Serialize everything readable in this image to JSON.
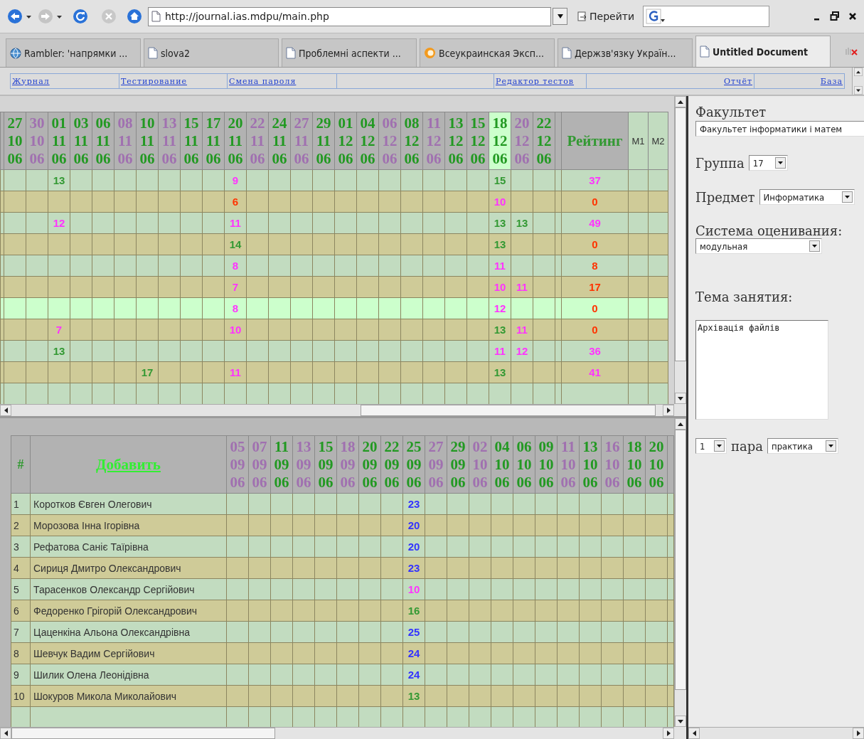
{
  "toolbar": {
    "url": "http://journal.ias.mdpu/main.php",
    "go_button": "Перейти"
  },
  "tabs": [
    {
      "label": "Rambler: 'напрямки ...",
      "kind": "globe",
      "selected": false
    },
    {
      "label": "slova2",
      "kind": "page",
      "selected": false
    },
    {
      "label": "Проблемні аспекти ...",
      "kind": "page",
      "selected": false
    },
    {
      "label": "Всеукраинская Эксп...",
      "kind": "flame",
      "selected": false
    },
    {
      "label": "Держзв'язку Україн...",
      "kind": "page",
      "selected": false
    },
    {
      "label": "Untitled Document",
      "kind": "page",
      "selected": true
    }
  ],
  "nav": {
    "left": [
      "Журнал",
      "Тестирование",
      "Смена пароля"
    ],
    "right": [
      "Редактор тестов",
      "Отчёт",
      "База"
    ]
  },
  "grades": {
    "columns": [
      {
        "day": "27",
        "month": "10",
        "year": "06",
        "color": "#229922",
        "selected": false
      },
      {
        "day": "30",
        "month": "10",
        "year": "06",
        "color": "#a070b0",
        "selected": false
      },
      {
        "day": "01",
        "month": "11",
        "year": "06",
        "color": "#229922",
        "selected": false
      },
      {
        "day": "03",
        "month": "11",
        "year": "06",
        "color": "#229922",
        "selected": false
      },
      {
        "day": "06",
        "month": "11",
        "year": "06",
        "color": "#229922",
        "selected": false
      },
      {
        "day": "08",
        "month": "11",
        "year": "06",
        "color": "#a070b0",
        "selected": false
      },
      {
        "day": "10",
        "month": "11",
        "year": "06",
        "color": "#229922",
        "selected": false
      },
      {
        "day": "13",
        "month": "11",
        "year": "06",
        "color": "#a070b0",
        "selected": false
      },
      {
        "day": "15",
        "month": "11",
        "year": "06",
        "color": "#229922",
        "selected": false
      },
      {
        "day": "17",
        "month": "11",
        "year": "06",
        "color": "#229922",
        "selected": false
      },
      {
        "day": "20",
        "month": "11",
        "year": "06",
        "color": "#229922",
        "selected": false
      },
      {
        "day": "22",
        "month": "11",
        "year": "06",
        "color": "#a070b0",
        "selected": false
      },
      {
        "day": "24",
        "month": "11",
        "year": "06",
        "color": "#229922",
        "selected": false
      },
      {
        "day": "27",
        "month": "11",
        "year": "06",
        "color": "#a070b0",
        "selected": false
      },
      {
        "day": "29",
        "month": "11",
        "year": "06",
        "color": "#229922",
        "selected": false
      },
      {
        "day": "01",
        "month": "12",
        "year": "06",
        "color": "#229922",
        "selected": false
      },
      {
        "day": "04",
        "month": "12",
        "year": "06",
        "color": "#229922",
        "selected": false
      },
      {
        "day": "06",
        "month": "12",
        "year": "06",
        "color": "#a070b0",
        "selected": false
      },
      {
        "day": "08",
        "month": "12",
        "year": "06",
        "color": "#229922",
        "selected": false
      },
      {
        "day": "11",
        "month": "12",
        "year": "06",
        "color": "#a070b0",
        "selected": false
      },
      {
        "day": "13",
        "month": "12",
        "year": "06",
        "color": "#229922",
        "selected": false
      },
      {
        "day": "15",
        "month": "12",
        "year": "06",
        "color": "#229922",
        "selected": false
      },
      {
        "day": "18",
        "month": "12",
        "year": "06",
        "color": "#229922",
        "selected": true
      },
      {
        "day": "20",
        "month": "12",
        "year": "06",
        "color": "#a070b0",
        "selected": false
      },
      {
        "day": "22",
        "month": "12",
        "year": "06",
        "color": "#229922",
        "selected": false
      }
    ],
    "rating_label": "Рейтинг",
    "extra_columns": [
      "M1",
      "M2"
    ],
    "rows": [
      {
        "highlighted": false,
        "rating": {
          "text": "37",
          "color": "#ff33ff"
        },
        "cells": [
          null,
          null,
          {
            "text": "13",
            "color": "#339933"
          },
          null,
          null,
          null,
          null,
          null,
          null,
          null,
          {
            "text": "9",
            "color": "#ff33ff"
          },
          null,
          null,
          null,
          null,
          null,
          null,
          null,
          null,
          null,
          null,
          null,
          {
            "text": "15",
            "color": "#339933"
          },
          null,
          null
        ]
      },
      {
        "highlighted": false,
        "rating": {
          "text": "0",
          "color": "#ff3300"
        },
        "cells": [
          null,
          null,
          null,
          null,
          null,
          null,
          null,
          null,
          null,
          null,
          {
            "text": "6",
            "color": "#ff3300"
          },
          null,
          null,
          null,
          null,
          null,
          null,
          null,
          null,
          null,
          null,
          null,
          {
            "text": "10",
            "color": "#ff33ff"
          },
          null,
          null
        ]
      },
      {
        "highlighted": false,
        "rating": {
          "text": "49",
          "color": "#ff33ff"
        },
        "cells": [
          null,
          null,
          {
            "text": "12",
            "color": "#ff33ff"
          },
          null,
          null,
          null,
          null,
          null,
          null,
          null,
          {
            "text": "11",
            "color": "#ff33ff"
          },
          null,
          null,
          null,
          null,
          null,
          null,
          null,
          null,
          null,
          null,
          null,
          {
            "text": "13",
            "color": "#339933"
          },
          {
            "text": "13",
            "color": "#339933"
          },
          null
        ]
      },
      {
        "highlighted": false,
        "rating": {
          "text": "0",
          "color": "#ff3300"
        },
        "cells": [
          null,
          null,
          null,
          null,
          null,
          null,
          null,
          null,
          null,
          null,
          {
            "text": "14",
            "color": "#339933"
          },
          null,
          null,
          null,
          null,
          null,
          null,
          null,
          null,
          null,
          null,
          null,
          {
            "text": "13",
            "color": "#339933"
          },
          null,
          null
        ]
      },
      {
        "highlighted": false,
        "rating": {
          "text": "8",
          "color": "#ff3300"
        },
        "cells": [
          null,
          null,
          null,
          null,
          null,
          null,
          null,
          null,
          null,
          null,
          {
            "text": "8",
            "color": "#ff33ff"
          },
          null,
          null,
          null,
          null,
          null,
          null,
          null,
          null,
          null,
          null,
          null,
          {
            "text": "11",
            "color": "#ff33ff"
          },
          null,
          null
        ]
      },
      {
        "highlighted": false,
        "rating": {
          "text": "17",
          "color": "#ff3300"
        },
        "cells": [
          null,
          null,
          null,
          null,
          null,
          null,
          null,
          null,
          null,
          null,
          {
            "text": "7",
            "color": "#ff33ff"
          },
          null,
          null,
          null,
          null,
          null,
          null,
          null,
          null,
          null,
          null,
          null,
          {
            "text": "10",
            "color": "#ff33ff"
          },
          {
            "text": "11",
            "color": "#ff33ff"
          },
          null
        ]
      },
      {
        "highlighted": true,
        "rating": {
          "text": "0",
          "color": "#ff3300"
        },
        "cells": [
          null,
          null,
          null,
          null,
          null,
          null,
          null,
          null,
          null,
          null,
          {
            "text": "8",
            "color": "#ff33ff"
          },
          null,
          null,
          null,
          null,
          null,
          null,
          null,
          null,
          null,
          null,
          null,
          {
            "text": "12",
            "color": "#ff33ff"
          },
          null,
          null
        ]
      },
      {
        "highlighted": false,
        "rating": {
          "text": "0",
          "color": "#ff3300"
        },
        "cells": [
          null,
          null,
          {
            "text": "7",
            "color": "#ff33ff"
          },
          null,
          null,
          null,
          null,
          null,
          null,
          null,
          {
            "text": "10",
            "color": "#ff33ff"
          },
          null,
          null,
          null,
          null,
          null,
          null,
          null,
          null,
          null,
          null,
          null,
          {
            "text": "13",
            "color": "#339933"
          },
          {
            "text": "11",
            "color": "#ff33ff"
          },
          null
        ]
      },
      {
        "highlighted": false,
        "rating": {
          "text": "36",
          "color": "#ff33ff"
        },
        "cells": [
          null,
          null,
          {
            "text": "13",
            "color": "#339933"
          },
          null,
          null,
          null,
          null,
          null,
          null,
          null,
          null,
          null,
          null,
          null,
          null,
          null,
          null,
          null,
          null,
          null,
          null,
          null,
          {
            "text": "11",
            "color": "#ff33ff"
          },
          {
            "text": "12",
            "color": "#ff33ff"
          },
          null
        ]
      },
      {
        "highlighted": false,
        "rating": {
          "text": "41",
          "color": "#ff33ff"
        },
        "cells": [
          null,
          null,
          null,
          null,
          null,
          null,
          {
            "text": "17",
            "color": "#339933"
          },
          null,
          null,
          null,
          {
            "text": "11",
            "color": "#ff33ff"
          },
          null,
          null,
          null,
          null,
          null,
          null,
          null,
          null,
          null,
          null,
          null,
          {
            "text": "13",
            "color": "#339933"
          },
          null,
          null
        ]
      }
    ]
  },
  "roster": {
    "number_label": "#",
    "add_link": "Добавить",
    "columns": [
      {
        "day": "05",
        "month": "09",
        "year": "06",
        "color": "#a070b0"
      },
      {
        "day": "07",
        "month": "09",
        "year": "06",
        "color": "#a070b0"
      },
      {
        "day": "11",
        "month": "09",
        "year": "06",
        "color": "#229922"
      },
      {
        "day": "13",
        "month": "09",
        "year": "06",
        "color": "#a070b0"
      },
      {
        "day": "15",
        "month": "09",
        "year": "06",
        "color": "#229922"
      },
      {
        "day": "18",
        "month": "09",
        "year": "06",
        "color": "#a070b0"
      },
      {
        "day": "20",
        "month": "09",
        "year": "06",
        "color": "#229922"
      },
      {
        "day": "22",
        "month": "09",
        "year": "06",
        "color": "#229922"
      },
      {
        "day": "25",
        "month": "09",
        "year": "06",
        "color": "#229922"
      },
      {
        "day": "27",
        "month": "09",
        "year": "06",
        "color": "#a070b0"
      },
      {
        "day": "29",
        "month": "09",
        "year": "06",
        "color": "#229922"
      },
      {
        "day": "02",
        "month": "10",
        "year": "06",
        "color": "#a070b0"
      },
      {
        "day": "04",
        "month": "10",
        "year": "06",
        "color": "#229922"
      },
      {
        "day": "06",
        "month": "10",
        "year": "06",
        "color": "#229922"
      },
      {
        "day": "09",
        "month": "10",
        "year": "06",
        "color": "#229922"
      },
      {
        "day": "11",
        "month": "10",
        "year": "06",
        "color": "#a070b0"
      },
      {
        "day": "13",
        "month": "10",
        "year": "06",
        "color": "#229922"
      },
      {
        "day": "16",
        "month": "10",
        "year": "06",
        "color": "#a070b0"
      },
      {
        "day": "18",
        "month": "10",
        "year": "06",
        "color": "#229922"
      },
      {
        "day": "20",
        "month": "10",
        "year": "06",
        "color": "#229922"
      }
    ],
    "rows": [
      {
        "number": "1",
        "name": "Коротков Євген Олегович",
        "cells": [
          null,
          null,
          null,
          null,
          null,
          null,
          null,
          null,
          {
            "text": "23",
            "color": "#3333ff"
          },
          null,
          null,
          null,
          null,
          null,
          null,
          null,
          null,
          null,
          null,
          null
        ]
      },
      {
        "number": "2",
        "name": "Морозова Інна Ігорівна",
        "cells": [
          null,
          null,
          null,
          null,
          null,
          null,
          null,
          null,
          {
            "text": "20",
            "color": "#3333ff"
          },
          null,
          null,
          null,
          null,
          null,
          null,
          null,
          null,
          null,
          null,
          null
        ]
      },
      {
        "number": "3",
        "name": "Рефатова Саніє Таїрівна",
        "cells": [
          null,
          null,
          null,
          null,
          null,
          null,
          null,
          null,
          {
            "text": "20",
            "color": "#3333ff"
          },
          null,
          null,
          null,
          null,
          null,
          null,
          null,
          null,
          null,
          null,
          null
        ]
      },
      {
        "number": "4",
        "name": "Сириця Дмитро Олександрович",
        "cells": [
          null,
          null,
          null,
          null,
          null,
          null,
          null,
          null,
          {
            "text": "23",
            "color": "#3333ff"
          },
          null,
          null,
          null,
          null,
          null,
          null,
          null,
          null,
          null,
          null,
          null
        ]
      },
      {
        "number": "5",
        "name": "Тарасенков Олександр Сергійович",
        "cells": [
          null,
          null,
          null,
          null,
          null,
          null,
          null,
          null,
          {
            "text": "10",
            "color": "#ff33ff"
          },
          null,
          null,
          null,
          null,
          null,
          null,
          null,
          null,
          null,
          null,
          null
        ]
      },
      {
        "number": "6",
        "name": "Федоренко Грігорій Олександрович",
        "cells": [
          null,
          null,
          null,
          null,
          null,
          null,
          null,
          null,
          {
            "text": "16",
            "color": "#339933"
          },
          null,
          null,
          null,
          null,
          null,
          null,
          null,
          null,
          null,
          null,
          null
        ]
      },
      {
        "number": "7",
        "name": "Цаценкіна Альона Олександрівна",
        "cells": [
          null,
          null,
          null,
          null,
          null,
          null,
          null,
          null,
          {
            "text": "25",
            "color": "#3333ff"
          },
          null,
          null,
          null,
          null,
          null,
          null,
          null,
          null,
          null,
          null,
          null
        ]
      },
      {
        "number": "8",
        "name": "Шевчук Вадим Сергійович",
        "cells": [
          null,
          null,
          null,
          null,
          null,
          null,
          null,
          null,
          {
            "text": "24",
            "color": "#3333ff"
          },
          null,
          null,
          null,
          null,
          null,
          null,
          null,
          null,
          null,
          null,
          null
        ]
      },
      {
        "number": "9",
        "name": "Шилик Олена Леонідівна",
        "cells": [
          null,
          null,
          null,
          null,
          null,
          null,
          null,
          null,
          {
            "text": "24",
            "color": "#3333ff"
          },
          null,
          null,
          null,
          null,
          null,
          null,
          null,
          null,
          null,
          null,
          null
        ]
      },
      {
        "number": "10",
        "name": "Шокуров Микола Миколайович",
        "cells": [
          null,
          null,
          null,
          null,
          null,
          null,
          null,
          null,
          {
            "text": "13",
            "color": "#339933"
          },
          null,
          null,
          null,
          null,
          null,
          null,
          null,
          null,
          null,
          null,
          null
        ]
      }
    ]
  },
  "sidebar": {
    "faculty_label": "Факультет",
    "faculty": "Факультет інформатики і матем",
    "group_label": "Группа",
    "group": "17",
    "subject_label": "Предмет",
    "subject": "Информатика",
    "grading_label": "Система оценивания:",
    "grading": "модульная",
    "topic_label": "Тема занятия:",
    "topic": "Архівація файлів",
    "pair_number": "1",
    "pair_label": "пара",
    "lesson_type": "практика"
  }
}
